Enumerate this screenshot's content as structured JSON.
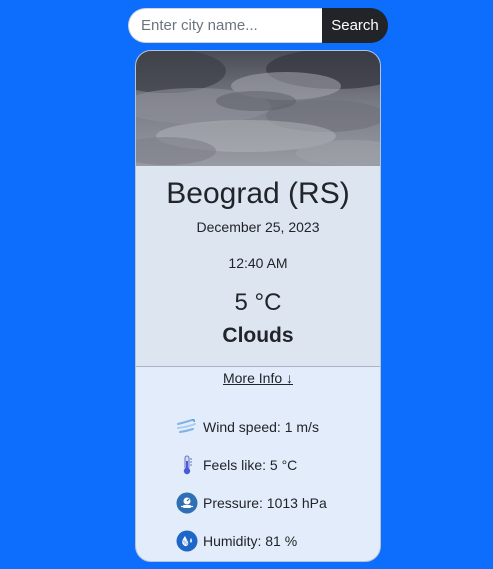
{
  "search": {
    "placeholder": "Enter city name...",
    "button_label": "Search"
  },
  "weather": {
    "city": "Beograd (RS)",
    "date": "December 25, 2023",
    "time": "12:40 AM",
    "temperature": "5 °C",
    "condition": "Clouds",
    "more_info_label": "More Info ↓",
    "details": [
      {
        "icon": "wind-icon",
        "label": "Wind speed: 1 m/s"
      },
      {
        "icon": "thermometer-icon",
        "label": "Feels like: 5 °C"
      },
      {
        "icon": "pressure-gauge-icon",
        "label": "Pressure: 1013 hPa"
      },
      {
        "icon": "humidity-icon",
        "label": "Humidity: 81 %"
      }
    ]
  },
  "colors": {
    "page_background": "#0d6efd",
    "search_button": "#212529",
    "card_top": "#dde5f1",
    "card_bottom": "#e3ecfa"
  }
}
